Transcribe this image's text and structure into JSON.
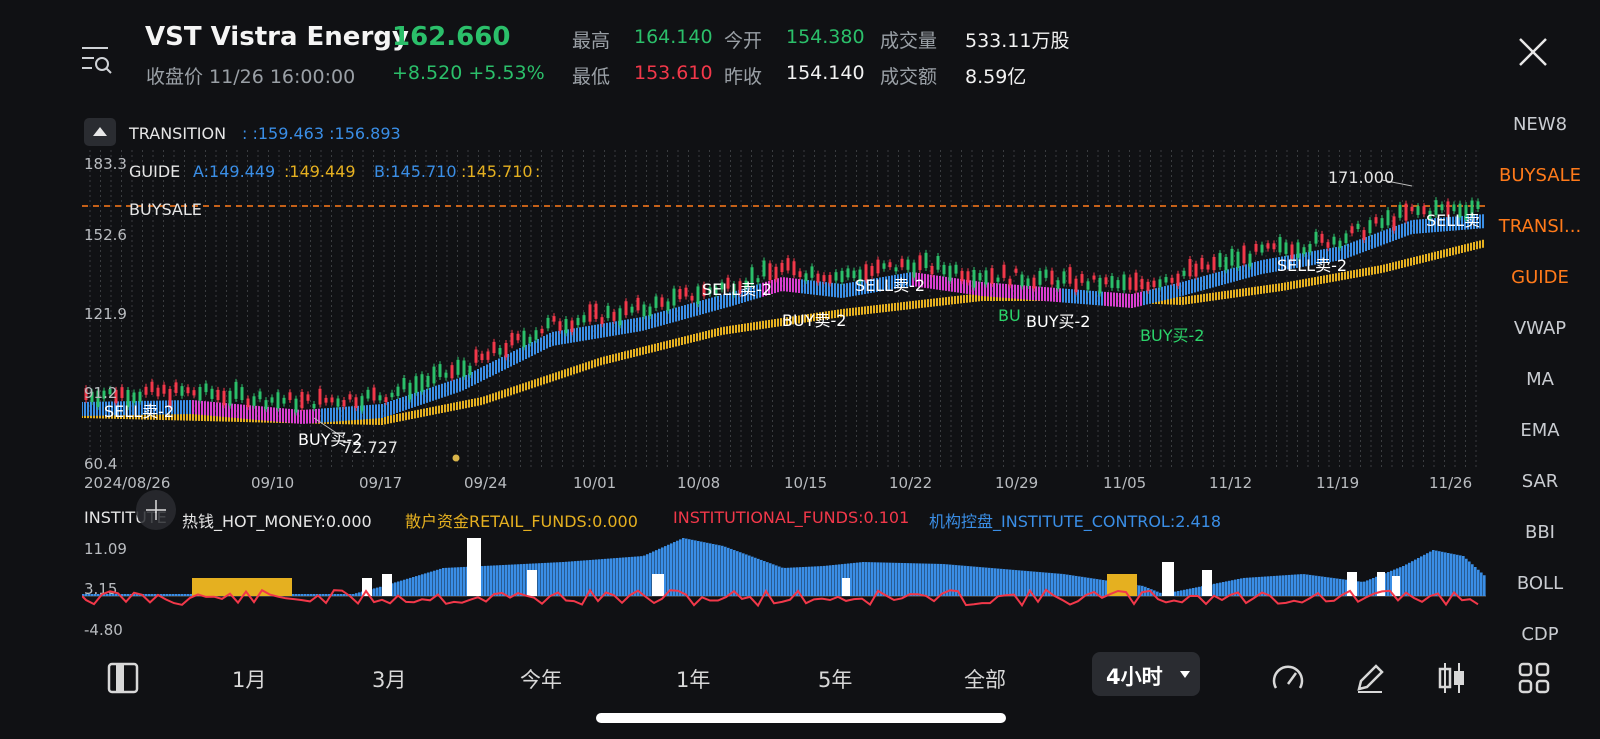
{
  "header": {
    "ticker_title": "VST  Vistra Energy",
    "price": "162.660",
    "close_label": "收盘价 11/26 16:00:00",
    "change": "+8.520  +5.53%",
    "high_label": "最高",
    "high": "164.140",
    "open_label": "今开",
    "open": "154.380",
    "volume_label": "成交量",
    "volume": "533.11万股",
    "low_label": "最低",
    "low": "153.610",
    "prev_close_label": "昨收",
    "prev_close": "154.140",
    "turnover_label": "成交额",
    "turnover": "8.59亿"
  },
  "main_chart": {
    "transition_label": "TRANSITION",
    "transition_values": ": :159.463  :156.893",
    "guide_label": "GUIDE",
    "guide_a": "A:149.449",
    "guide_a2": ":149.449",
    "guide_b": "B:145.710",
    "guide_b2": ":145.710",
    "guide_end": ":",
    "buysale_label": "BUYSALE",
    "y_labels": [
      "183.3",
      "152.6",
      "121.9",
      "91.2",
      "60.4"
    ],
    "x_labels": [
      "2024/08/26",
      "09/10",
      "09/17",
      "09/24",
      "10/01",
      "10/08",
      "10/15",
      "10/22",
      "10/29",
      "11/05",
      "11/12",
      "11/19",
      "11/26"
    ],
    "annotations": {
      "high_marker": "171.000",
      "low_marker": "72.727",
      "sell1": "SELL卖-2",
      "buy1": "BUY买-2",
      "sell2": "SELL卖-2",
      "buy2": "BUY卖-2",
      "sell3": "SELL卖-2",
      "buy3": "BUY买-2",
      "buy3_prefix": "BU",
      "buy4": "BUY买-2",
      "sell4": "SELL卖-2",
      "sell5": "SELL卖"
    }
  },
  "institute": {
    "label": "INSTITUTE",
    "hot_money": "热钱_HOT_MONEY:0.000",
    "retail": "散户资金RETAIL_FUNDS:0.000",
    "institutional": "INSTITUTIONAL_FUNDS:0.101",
    "control": "机构控盘_INSTITUTE_CONTROL:2.418",
    "y_labels": [
      "11.09",
      "3.15",
      "-4.80"
    ]
  },
  "side_menu": [
    {
      "label": "NEW8",
      "active": false
    },
    {
      "label": "BUYSALE",
      "active": true
    },
    {
      "label": "TRANSI...",
      "active": true
    },
    {
      "label": "GUIDE",
      "active": true
    },
    {
      "label": "VWAP",
      "active": false
    },
    {
      "label": "MA",
      "active": false
    },
    {
      "label": "EMA",
      "active": false
    },
    {
      "label": "SAR",
      "active": false
    },
    {
      "label": "BBI",
      "active": false
    },
    {
      "label": "BOLL",
      "active": false
    },
    {
      "label": "CDP",
      "active": false
    }
  ],
  "timeframes": {
    "items": [
      "1月",
      "3月",
      "今年",
      "1年",
      "5年",
      "全部"
    ],
    "active": "4小时"
  },
  "colors": {
    "up": "#2bbf6a",
    "down": "#f2384a",
    "accent": "#ff7a1a",
    "guide_blue": "#3a8ee6",
    "guide_yellow": "#e5b020"
  }
}
